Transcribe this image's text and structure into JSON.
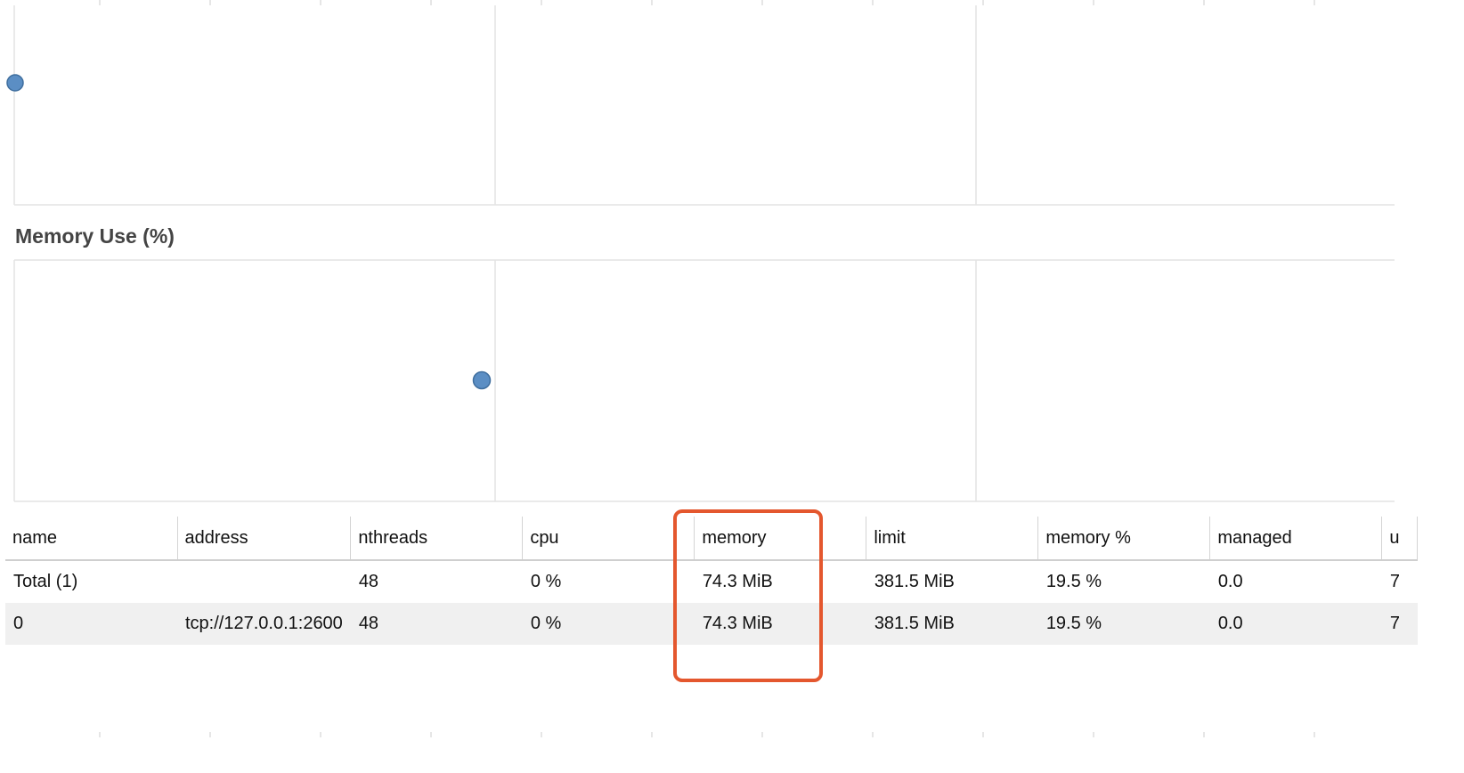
{
  "memory_section": {
    "title": "Memory Use (%)"
  },
  "charts": [
    {
      "name": "upper-scatter",
      "points": [
        {
          "x": 0,
          "y": 0.6
        }
      ],
      "point_color": "#5b8ec4"
    },
    {
      "name": "memory-use-scatter",
      "points": [
        {
          "x": 0.97,
          "y": 0.5
        }
      ],
      "point_color": "#5b8ec4"
    }
  ],
  "table": {
    "columns": [
      "name",
      "address",
      "nthreads",
      "cpu",
      "memory",
      "limit",
      "memory %",
      "managed",
      "u"
    ],
    "rows": [
      [
        "Total (1)",
        "",
        "48",
        "0 %",
        "74.3 MiB",
        "381.5 MiB",
        "19.5 %",
        "0.0",
        "7"
      ],
      [
        "0",
        "tcp://127.0.0.1:2600",
        "48",
        "0 %",
        "74.3 MiB",
        "381.5 MiB",
        "19.5 %",
        "0.0",
        "7"
      ]
    ]
  },
  "highlight": {
    "target_column": "memory",
    "color": "#e4572e"
  }
}
